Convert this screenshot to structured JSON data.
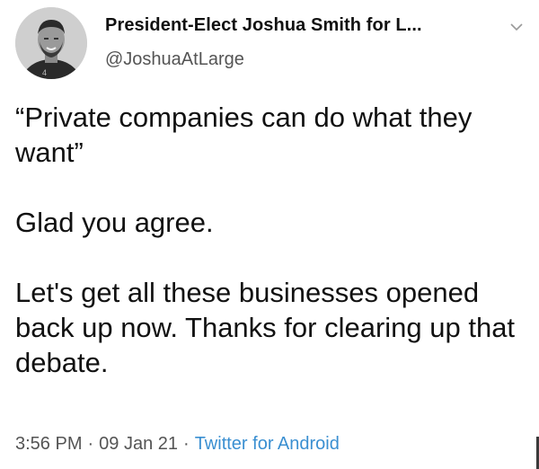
{
  "tweet": {
    "author": {
      "display_name": "President-Elect Joshua Smith for L...",
      "handle": "@JoshuaAtLarge"
    },
    "body": {
      "paragraphs": [
        "“Private companies can do what they want”",
        "Glad you agree.",
        "Let's get all these businesses opened back up now. Thanks for clearing up that debate."
      ]
    },
    "footer": {
      "time": "3:56 PM",
      "separator": "·",
      "date": "09 Jan 21",
      "source": "Twitter for Android"
    },
    "icons": {
      "avatar": "profile-photo",
      "menu": "chevron-down-icon"
    },
    "colors": {
      "source_link": "#3a8fd1",
      "secondary_text": "#545454"
    }
  }
}
